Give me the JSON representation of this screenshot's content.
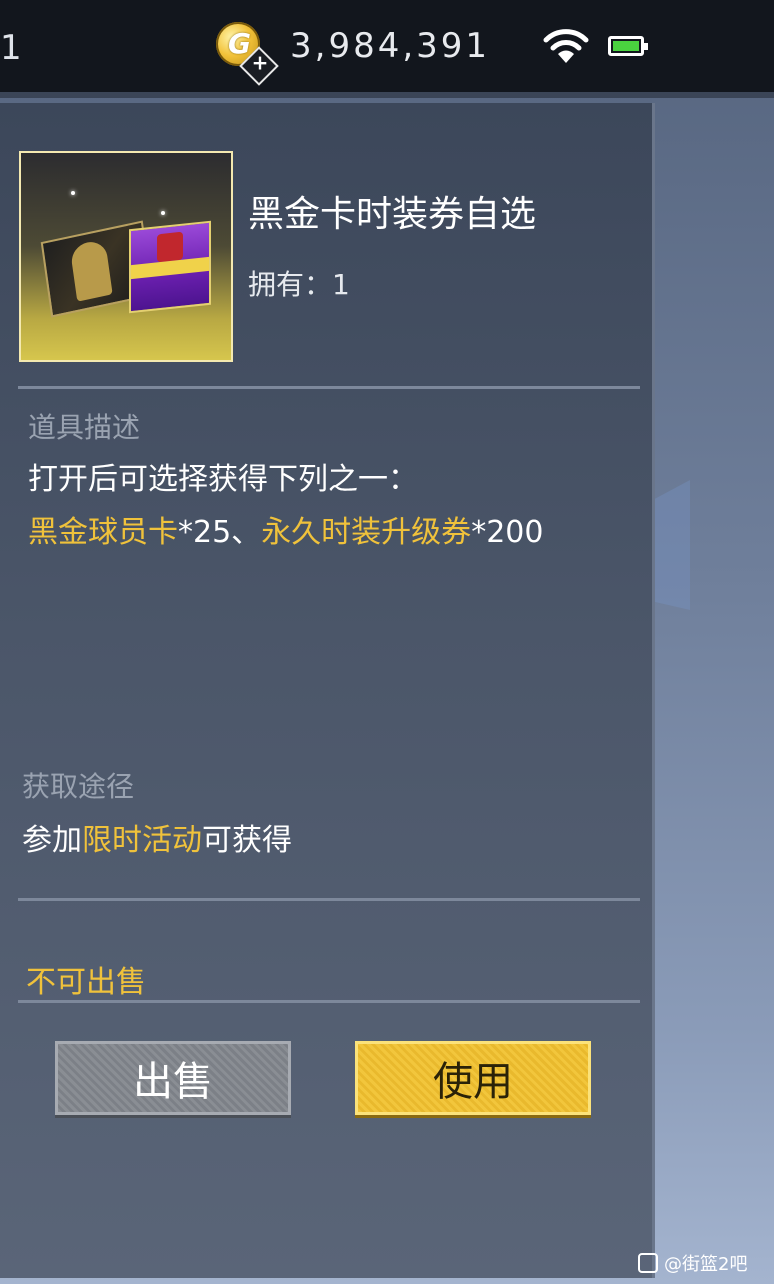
{
  "status_bar": {
    "left_partial_text": "1",
    "coin_letter": "G",
    "plus_symbol": "+",
    "coins": "3,984,391"
  },
  "item": {
    "name": "黑金卡时装券自选",
    "owned_label": "拥有：",
    "owned_count": "1"
  },
  "description": {
    "title": "道具描述",
    "line1": "打开后可选择获得下列之一：",
    "reward1": "黑金球员卡",
    "reward1_qty": "*25、",
    "reward2": "永久时装升级券",
    "reward2_qty": "*200"
  },
  "acquire": {
    "title": "获取途径",
    "prefix": "参加",
    "highlight": "限时活动",
    "suffix": "可获得"
  },
  "sale_status": "不可出售",
  "buttons": {
    "sell": "出售",
    "use": "使用"
  },
  "watermark": "@街篮2吧",
  "colors": {
    "accent_gold": "#f0c23b",
    "panel": "#4b5669",
    "battery_green": "#4ad23f"
  },
  "icons": [
    "gold-coin-icon",
    "add-coin-icon",
    "wifi-icon",
    "battery-icon"
  ]
}
